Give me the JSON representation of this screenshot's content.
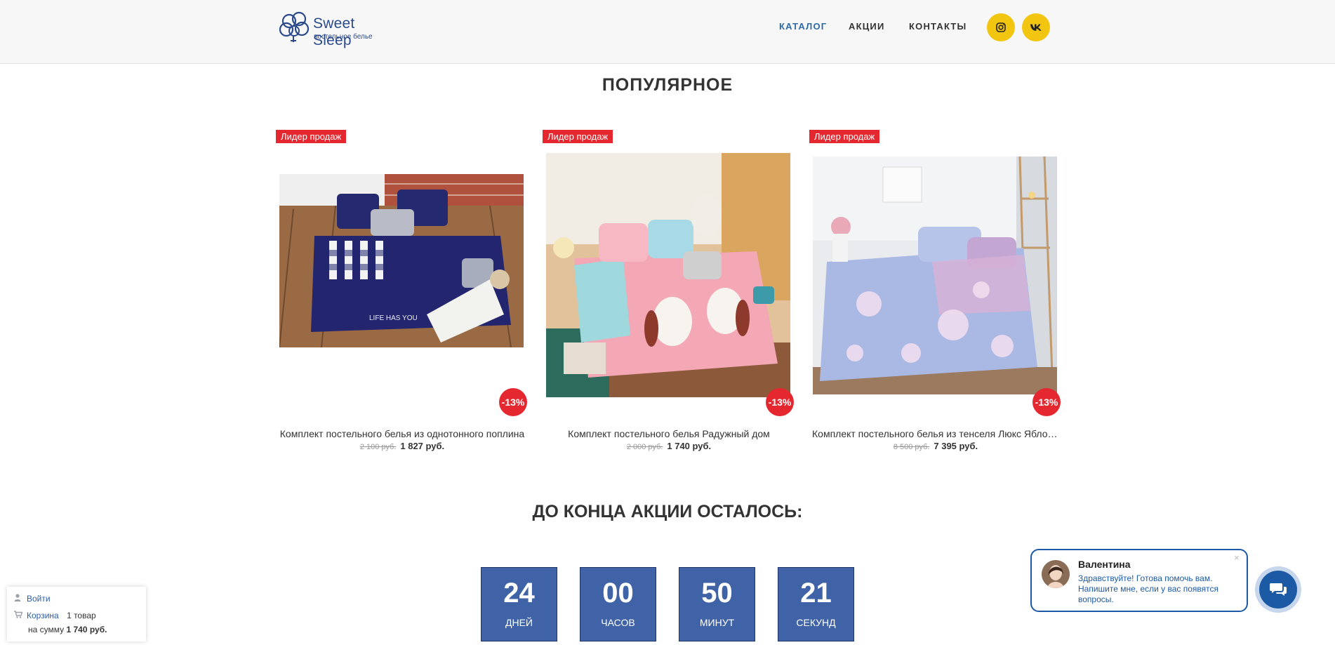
{
  "header": {
    "logo_brand": "Sweet Sleep",
    "logo_tagline": "постельное белье",
    "nav": [
      {
        "label": "КАТАЛОГ"
      },
      {
        "label": "АКЦИИ"
      },
      {
        "label": "КОНТАКТЫ"
      }
    ],
    "social_icons": [
      "instagram-icon",
      "vk-icon"
    ],
    "accent_color": "#f2c511",
    "active_nav_color": "#2f6aa6"
  },
  "popular": {
    "title": "ПОПУЛЯРНОЕ",
    "products": [
      {
        "badge": "Лидер продаж",
        "discount": "-13%",
        "name": "Комплект постельного белья из однотонного поплина",
        "old_price": "2 100 руб.",
        "price": "1 827 руб."
      },
      {
        "badge": "Лидер продаж",
        "discount": "-13%",
        "name": "Комплект постельного белья Радужный дом",
        "old_price": "2 000 руб.",
        "price": "1 740 руб."
      },
      {
        "badge": "Лидер продаж",
        "discount": "-13%",
        "name": "Комплект постельного белья из тенселя Люкс Яблоневый цвет",
        "old_price": "8 500 руб.",
        "price": "7 395 руб."
      }
    ]
  },
  "countdown": {
    "title": "ДО КОНЦА АКЦИИ ОСТАЛОСЬ:",
    "units": [
      {
        "value": "24",
        "label": "ДНЕЙ"
      },
      {
        "value": "00",
        "label": "ЧАСОВ"
      },
      {
        "value": "50",
        "label": "МИНУТ"
      },
      {
        "value": "21",
        "label": "СЕКУНД"
      }
    ]
  },
  "userbox": {
    "login": "Войти",
    "cart": "Корзина",
    "cart_count": "1 товар",
    "sum_prefix": "на сумму",
    "sum": "1 740 руб."
  },
  "chat": {
    "name": "Валентина",
    "message": "Здравствуйте! Готова помочь вам. Напишите мне, если у вас появятся вопросы.",
    "close": "×"
  }
}
